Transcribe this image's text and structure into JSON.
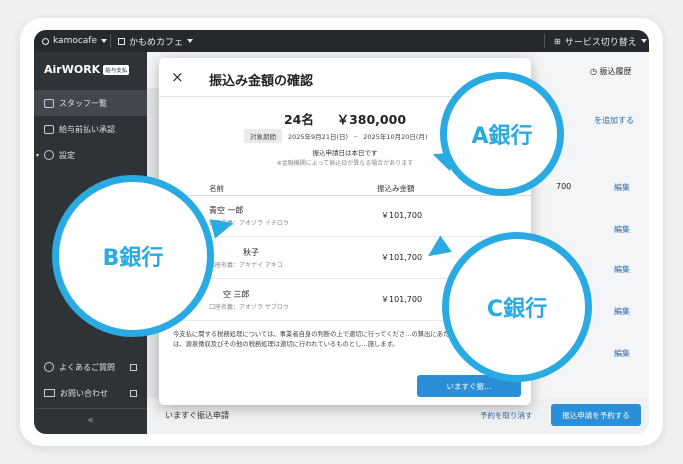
{
  "topbar": {
    "account": "kamocafe",
    "store_name": "かもめカフェ",
    "service_switch": "サービス切り替え"
  },
  "sidebar": {
    "logo_text": "AirWORK",
    "logo_badge": "給与支払",
    "items": [
      {
        "label": "スタッフ一覧"
      },
      {
        "label": "給与前払い承認"
      },
      {
        "label": "設定"
      }
    ],
    "bottom_items": [
      {
        "label": "よくあるご質問"
      },
      {
        "label": "お問い合わせ"
      }
    ],
    "collapse": "«"
  },
  "background": {
    "history_link": "振込履歴",
    "add_link": "を追加する",
    "edit_label": "編集",
    "partial_amount": "700",
    "bottom_label": "いますぐ振込申請",
    "bottom_link": "予約を取り消す",
    "bottom_button": "振込申請を予約する"
  },
  "modal": {
    "close": "×",
    "title": "振込み金額の確認",
    "summary_count": "24名",
    "summary_amount": "￥380,000",
    "period_label": "対象期間",
    "period_start": "2025年9月21日(日)",
    "period_sep": "–",
    "period_end": "2025年10月20日(月)",
    "request_date": "振込申請日は本日です",
    "note": "※金融機関によって振込日が異なる場合があります",
    "col_name": "名前",
    "col_amount": "振込み金額",
    "rows": [
      {
        "name": "青空 一郎",
        "kana": "口座名義：アオゾラ イチロウ",
        "amount": "￥101,700"
      },
      {
        "name": "秋子",
        "kana": "口座名義：アキナイ アキコ",
        "amount": "￥101,700"
      },
      {
        "name": "空 三郎",
        "kana": "口座名義：アオゾラ サブロウ",
        "amount": "￥101,700"
      }
    ],
    "footer_text": "今支払に関する税務処理については、事業者自身の判断の上で適切に行ってくださ…の算出にあたっては、源泉徴収及びその他の税務処理は適切に行われているものとし…施します。",
    "submit": "いますぐ振…"
  },
  "banks": {
    "a": "A銀行",
    "b": "B銀行",
    "c": "C銀行"
  },
  "colors": {
    "accent": "#29aae2",
    "button": "#2a8fd6",
    "sidebar": "#2e3338",
    "topbar": "#262a2e"
  }
}
